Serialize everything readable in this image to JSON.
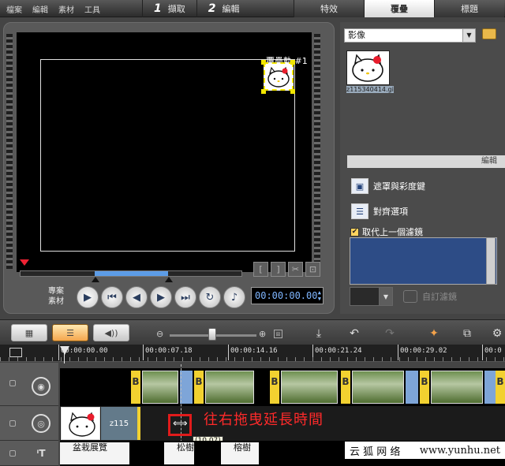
{
  "menu": [
    "檔案",
    "編輯",
    "素材",
    "工具"
  ],
  "steps": [
    {
      "num": "1",
      "label": "擷取"
    },
    {
      "num": "2",
      "label": "編輯"
    }
  ],
  "tabs": [
    "特效",
    "覆疊",
    "標題"
  ],
  "active_tab": "覆疊",
  "preview": {
    "overlay_label": "覆疊軌 #1",
    "edit_buttons": [
      "[",
      "]",
      "✂",
      "⊡"
    ],
    "mode_labels": [
      "專案",
      "素材"
    ],
    "timecode": "00:00:00.00"
  },
  "library": {
    "category": "影像",
    "thumb_caption": "z115340414.gi"
  },
  "edit_panel": {
    "header": "編輯",
    "mask_chroma": "遮罩與彩度鍵",
    "align_options": "對齊選項",
    "replace_filter": "取代上一個濾鏡",
    "replace_filter_checked": true,
    "custom_filter": "自訂濾鏡"
  },
  "ruler": [
    "00:00:00.00",
    "00:00:07.18",
    "00:00:14.16",
    "00:00:21.24",
    "00:00:29.02",
    "00:0"
  ],
  "overlay_track": {
    "clip_name": "z115",
    "drag_tip": "(10.07)",
    "annotation": "往右拖曳延長時間"
  },
  "title_track": [
    "盆栽展覽",
    "松樹",
    "榕樹"
  ],
  "watermark": {
    "cn": "云 狐 网 络",
    "en": "www.yunhu.net"
  },
  "colors": {
    "accent_selection": "#5c9ce6",
    "annotation_red": "#e01b1b",
    "overlay_handle": "#f2e600",
    "filter_list_bg": "#2d4c86"
  }
}
